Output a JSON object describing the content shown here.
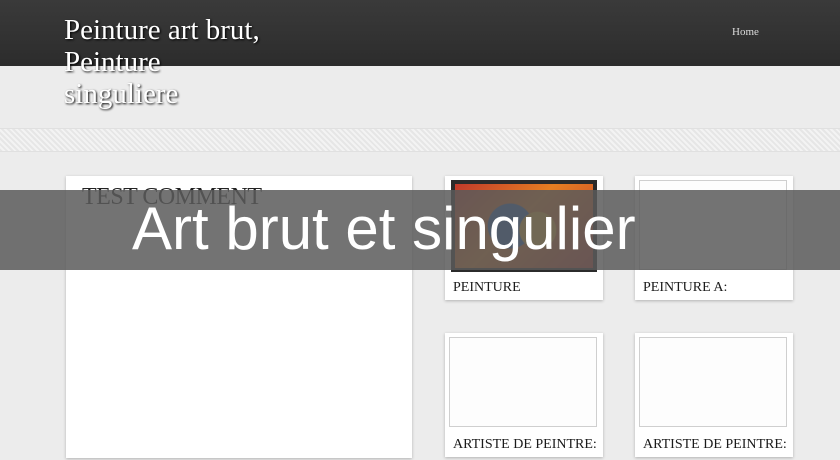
{
  "header": {
    "title_lines": [
      "Peinture art brut,",
      "Peinture",
      "singuliere"
    ],
    "nav": {
      "home_label": "Home"
    }
  },
  "main_card": {
    "title": "TEST COMMENT"
  },
  "thumbnails": [
    {
      "label": "PEINTURE",
      "image": "painting"
    },
    {
      "label": "PEINTURE A:",
      "image": "blank"
    },
    {
      "label": "ARTISTE DE PEINTRE:",
      "image": "blank"
    },
    {
      "label": "ARTISTE DE PEINTRE:",
      "image": "blank"
    }
  ],
  "banner": {
    "text": "Art brut et singulier"
  }
}
